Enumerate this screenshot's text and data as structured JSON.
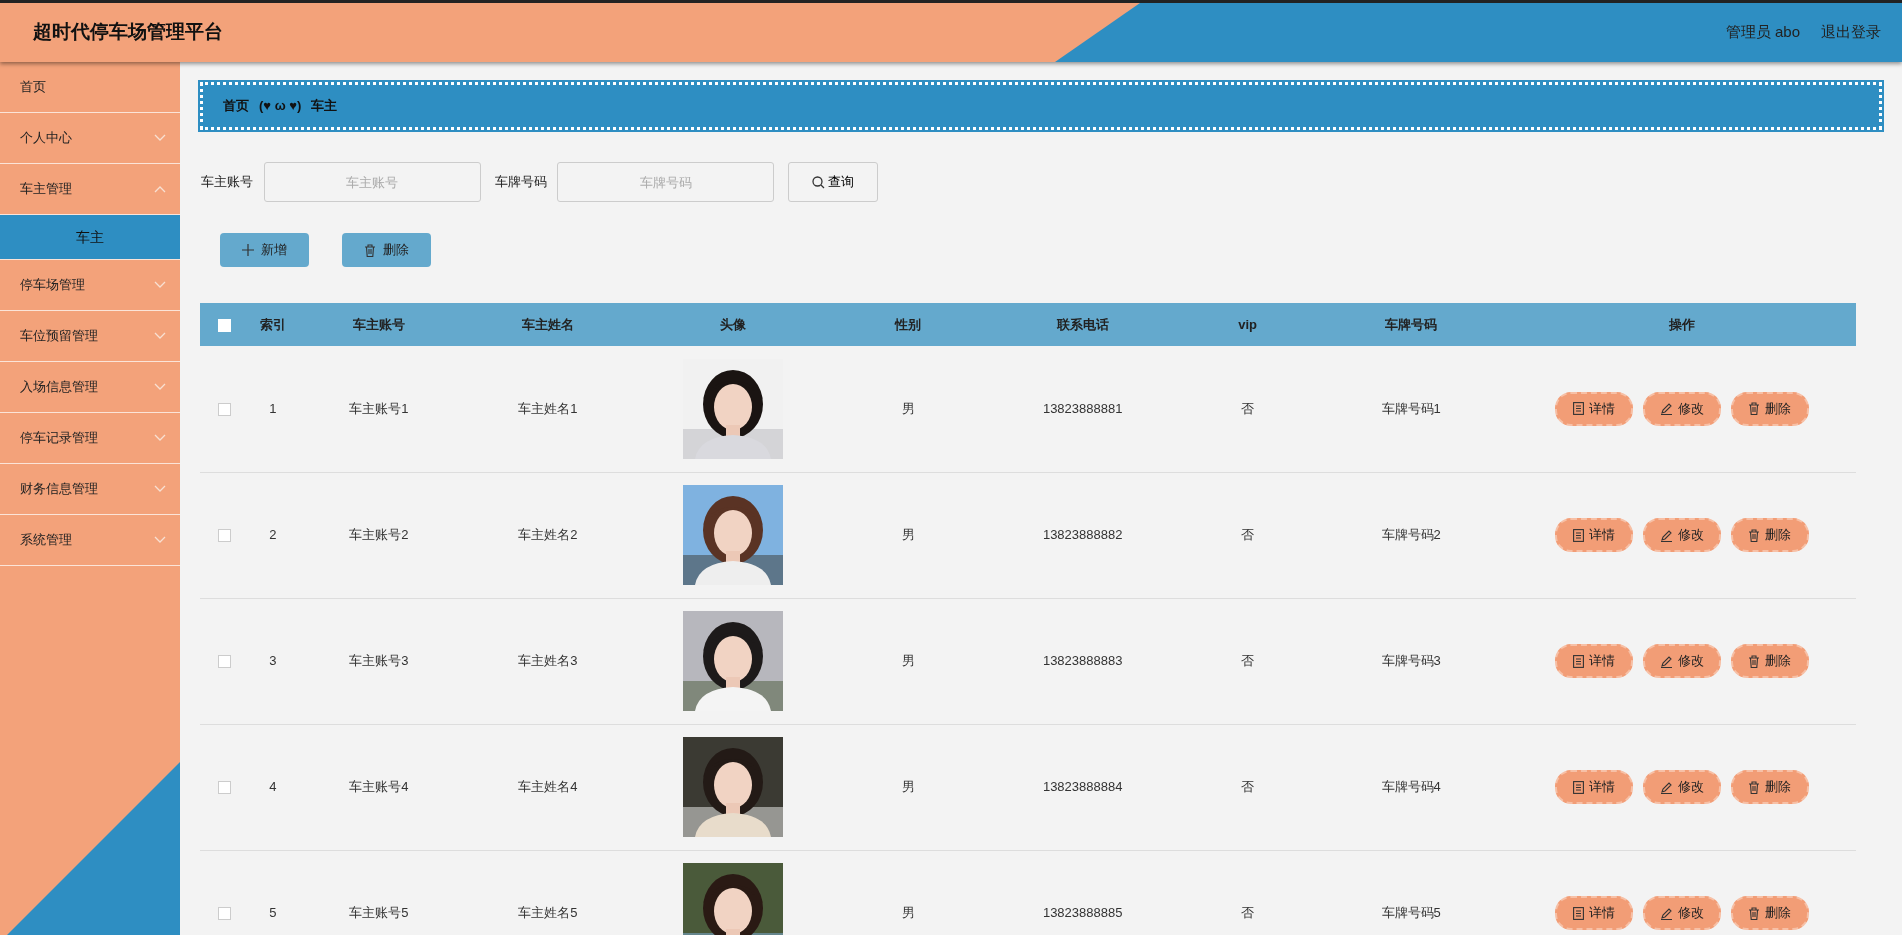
{
  "header": {
    "title": "超时代停车场管理平台",
    "user": "管理员 abo",
    "logout": "退出登录"
  },
  "sidebar": {
    "items": [
      {
        "label": "首页",
        "kind": "link"
      },
      {
        "label": "个人中心",
        "kind": "menu",
        "expanded": false
      },
      {
        "label": "车主管理",
        "kind": "menu",
        "expanded": true,
        "children": [
          {
            "label": "车主",
            "selected": true
          }
        ]
      },
      {
        "label": "停车场管理",
        "kind": "menu",
        "expanded": false
      },
      {
        "label": "车位预留管理",
        "kind": "menu",
        "expanded": false
      },
      {
        "label": "入场信息管理",
        "kind": "menu",
        "expanded": false
      },
      {
        "label": "停车记录管理",
        "kind": "menu",
        "expanded": false
      },
      {
        "label": "财务信息管理",
        "kind": "menu",
        "expanded": false
      },
      {
        "label": "系统管理",
        "kind": "menu",
        "expanded": false
      }
    ]
  },
  "breadcrumb": {
    "items": [
      "首页",
      "车主"
    ],
    "separator": "(♥ ω ♥)"
  },
  "search": {
    "fields": [
      {
        "label": "车主账号",
        "placeholder": "车主账号"
      },
      {
        "label": "车牌号码",
        "placeholder": "车牌号码"
      }
    ],
    "button": "查询"
  },
  "actions": [
    {
      "label": "新增",
      "kind": "add"
    },
    {
      "label": "删除",
      "kind": "delete"
    }
  ],
  "table": {
    "select_all": {
      "checked": false
    },
    "columns": [
      "索引",
      "车主账号",
      "车主姓名",
      "头像",
      "性别",
      "联系电话",
      "vip",
      "车牌号码",
      "操作"
    ],
    "rows": [
      {
        "checked": false,
        "cells": [
          "1",
          "车主账号1",
          "车主姓名1",
          null,
          "男",
          "13823888881",
          "否",
          "车牌号码1"
        ],
        "actions": [
          {
            "label": "详情",
            "kind": "detail"
          },
          {
            "label": "修改",
            "kind": "edit"
          },
          {
            "label": "删除",
            "kind": "delete"
          }
        ]
      },
      {
        "checked": false,
        "cells": [
          "2",
          "车主账号2",
          "车主姓名2",
          null,
          "男",
          "13823888882",
          "否",
          "车牌号码2"
        ],
        "actions": [
          {
            "label": "详情",
            "kind": "detail"
          },
          {
            "label": "修改",
            "kind": "edit"
          },
          {
            "label": "删除",
            "kind": "delete"
          }
        ]
      },
      {
        "checked": false,
        "cells": [
          "3",
          "车主账号3",
          "车主姓名3",
          null,
          "男",
          "13823888883",
          "否",
          "车牌号码3"
        ],
        "actions": [
          {
            "label": "详情",
            "kind": "detail"
          },
          {
            "label": "修改",
            "kind": "edit"
          },
          {
            "label": "删除",
            "kind": "delete"
          }
        ]
      },
      {
        "checked": false,
        "cells": [
          "4",
          "车主账号4",
          "车主姓名4",
          null,
          "男",
          "13823888884",
          "否",
          "车牌号码4"
        ],
        "actions": [
          {
            "label": "详情",
            "kind": "detail"
          },
          {
            "label": "修改",
            "kind": "edit"
          },
          {
            "label": "删除",
            "kind": "delete"
          }
        ]
      },
      {
        "checked": false,
        "cells": [
          "5",
          "车主账号5",
          "车主姓名5",
          null,
          "男",
          "13823888885",
          "否",
          "车牌号码5"
        ],
        "actions": [
          {
            "label": "详情",
            "kind": "detail"
          },
          {
            "label": "修改",
            "kind": "edit"
          },
          {
            "label": "删除",
            "kind": "delete"
          }
        ]
      }
    ]
  }
}
